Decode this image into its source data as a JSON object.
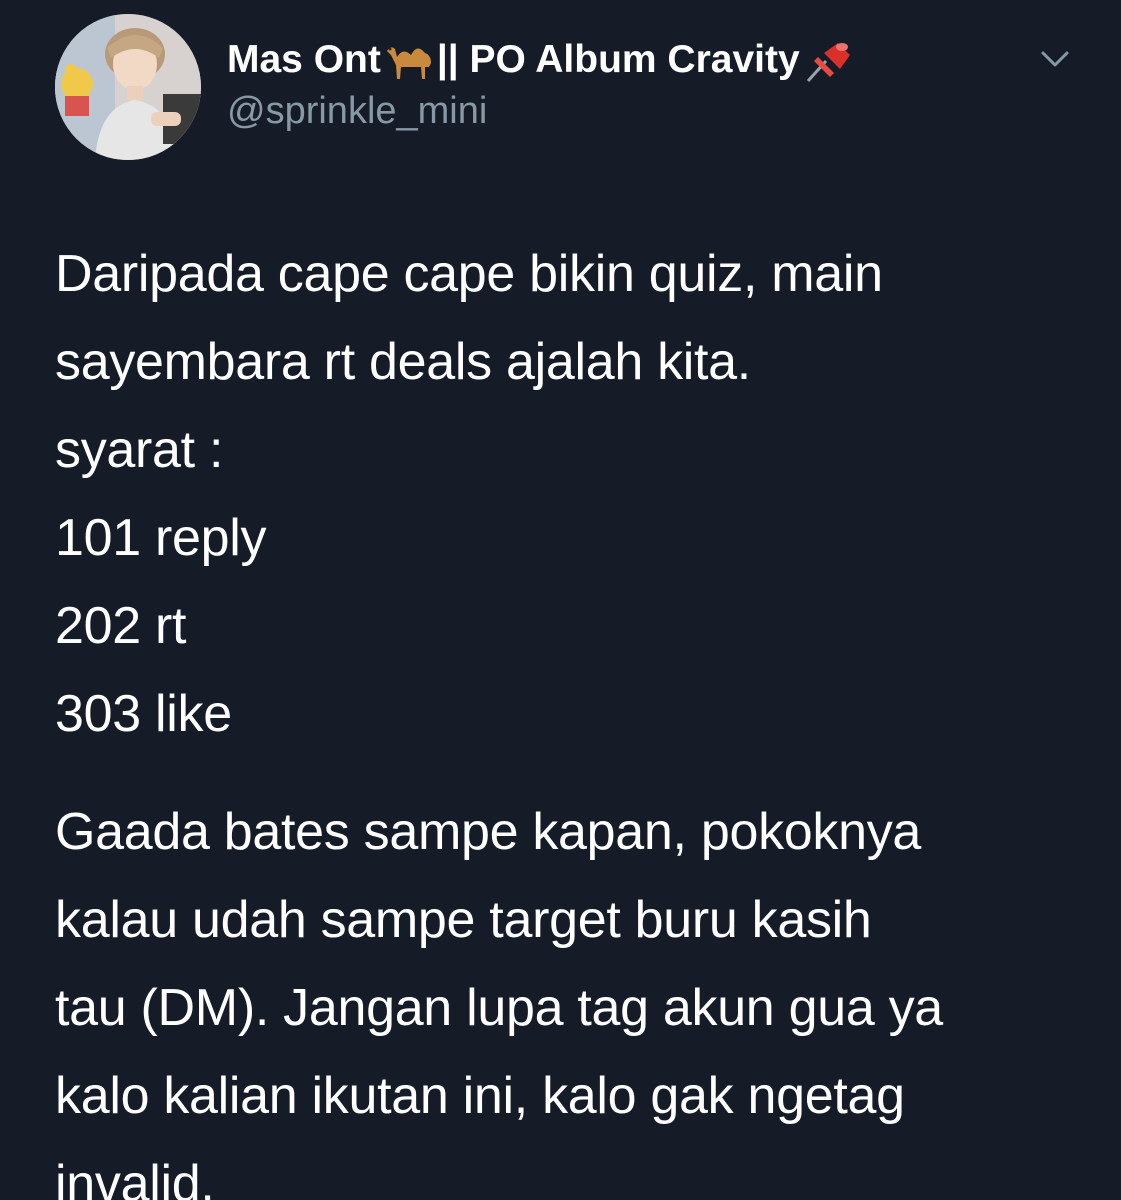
{
  "author": {
    "display_name_part1": "Mas Ont",
    "display_name_part2": " || PO Album Cravity",
    "emoji_1": "camel-emoji",
    "emoji_2": "pushpin-emoji",
    "handle": "@sprinkle_mini",
    "avatar": "profile-photo"
  },
  "menu": {
    "icon": "chevron-down-icon"
  },
  "tweet": {
    "paragraph1": [
      "Daripada cape cape bikin quiz, main",
      "sayembara rt deals ajalah kita.",
      "syarat :",
      "101 reply",
      "202 rt",
      "303 like"
    ],
    "paragraph2": [
      "Gaada bates sampe kapan, pokoknya",
      "kalau udah sampe target buru kasih",
      "tau (DM). Jangan lupa tag akun gua ya",
      "kalo kalian ikutan ini, kalo gak ngetag",
      "invalid."
    ]
  },
  "colors": {
    "background": "#151c28",
    "text": "#ffffff",
    "secondary_text": "#8899a6"
  }
}
